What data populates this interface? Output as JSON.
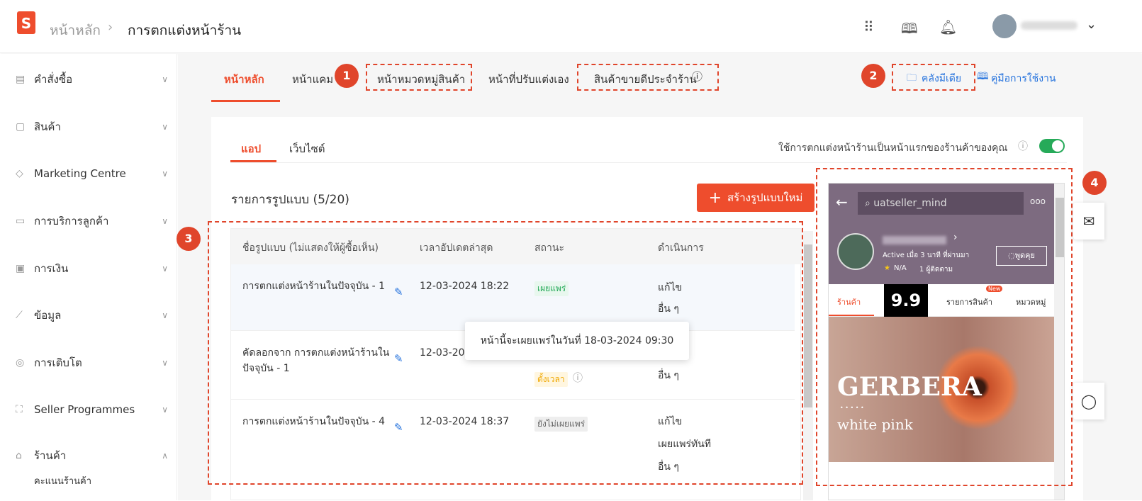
{
  "header": {
    "breadcrumb_home": "หน้าหลัก",
    "breadcrumb_sep": "›",
    "breadcrumb_current": "การตกแต่งหน้าร้าน",
    "icons": [
      "apps-grid-icon",
      "book-icon",
      "bell-icon"
    ],
    "user_menu_chevron": "⌄"
  },
  "sidebar": {
    "items": [
      {
        "label": "คำสั่งซื้อ",
        "icon": "clipboard-icon",
        "glyph": "▤",
        "chev": "∨"
      },
      {
        "label": "สินค้า",
        "icon": "box-icon",
        "glyph": "▢",
        "chev": "∨"
      },
      {
        "label": "Marketing Centre",
        "icon": "tag-icon",
        "glyph": "◇",
        "chev": "∨"
      },
      {
        "label": "การบริการลูกค้า",
        "icon": "chat-icon",
        "glyph": "▭",
        "chev": "∨"
      },
      {
        "label": "การเงิน",
        "icon": "wallet-icon",
        "glyph": "▣",
        "chev": "∨"
      },
      {
        "label": "ข้อมูล",
        "icon": "chart-icon",
        "glyph": "⟋",
        "chev": "∨"
      },
      {
        "label": "การเติบโต",
        "icon": "badge-icon",
        "glyph": "◎",
        "chev": "∨"
      },
      {
        "label": "Seller Programmes",
        "icon": "programs-icon",
        "glyph": "⛶",
        "chev": "∨"
      },
      {
        "label": "ร้านค้า",
        "icon": "shop-icon",
        "glyph": "⌂",
        "chev": "∧"
      }
    ],
    "subitem": "คะแนนร้านค้า"
  },
  "tabs": [
    "หน้าหลัก",
    "หน้าแคม",
    "หน้าหมวดหมู่สินค้า",
    "หน้าที่ปรับแต่งเอง",
    "สินค้าขายดีประจำร้าน"
  ],
  "links": {
    "media": "คลังมีเดีย",
    "guide": "คู่มือการใช้งาน"
  },
  "badges": [
    "1",
    "2",
    "3",
    "4"
  ],
  "subtabs": [
    "แอป",
    "เว็บไซต์"
  ],
  "toggle": {
    "label": "ใช้การตกแต่งหน้าร้านเป็นหน้าแรกของร้านค้าของคุณ",
    "on": true,
    "color": "#26aa59"
  },
  "list": {
    "title": "รายการรูปแบบ (5/20)",
    "create_button": "สร้างรูปแบบใหม่",
    "create_icon": "+"
  },
  "table": {
    "headers": [
      "ชื่อรูปแบบ (ไม่แสดงให้ผู้ซื้อเห็น)",
      "เวลาอัปเดตล่าสุด",
      "สถานะ",
      "ดำเนินการ"
    ],
    "rows": [
      {
        "name": "การตกแต่งหน้าร้านในปัจจุบัน - 1",
        "time": "12-03-2024 18:22",
        "status": "เผยแพร่",
        "actions": [
          "แก้ไข",
          "อื่น ๆ"
        ]
      },
      {
        "name": "คัดลอกจาก การตกแต่งหน้าร้านในปัจจุบัน - 1",
        "time": "12-03-20",
        "status": "ตั้งเวลา",
        "actions": [
          "อื่น ๆ"
        ]
      },
      {
        "name": "การตกแต่งหน้าร้านในปัจจุบัน - 4",
        "time": "12-03-2024 18:37",
        "status": "ยังไม่เผยแพร่",
        "actions": [
          "แก้ไข",
          "เผยแพร่ทันที",
          "อื่น ๆ"
        ]
      }
    ]
  },
  "tooltip": "หน้านี้จะเผยแพร่ในวันที่ 18-03-2024 09:30",
  "preview": {
    "search": "uatseller_mind",
    "more": "ooo",
    "active": "Active เมื่อ 3 นาที ที่ผ่านมา",
    "rating": "N/A",
    "followers": "1 ผู้ติดตาม",
    "chat": "พูดคุย",
    "tabs": [
      "ร้านค้า",
      "9.9",
      "รายการสินค้า",
      "หมวดหมู่"
    ],
    "new_badge": "New",
    "banner_title": "GERBERA",
    "banner_dots": "• • • • •",
    "banner_sub": "white pink"
  },
  "colors": {
    "accent": "#ee4d2d",
    "link": "#2673dd",
    "annotation": "#e0452b"
  }
}
